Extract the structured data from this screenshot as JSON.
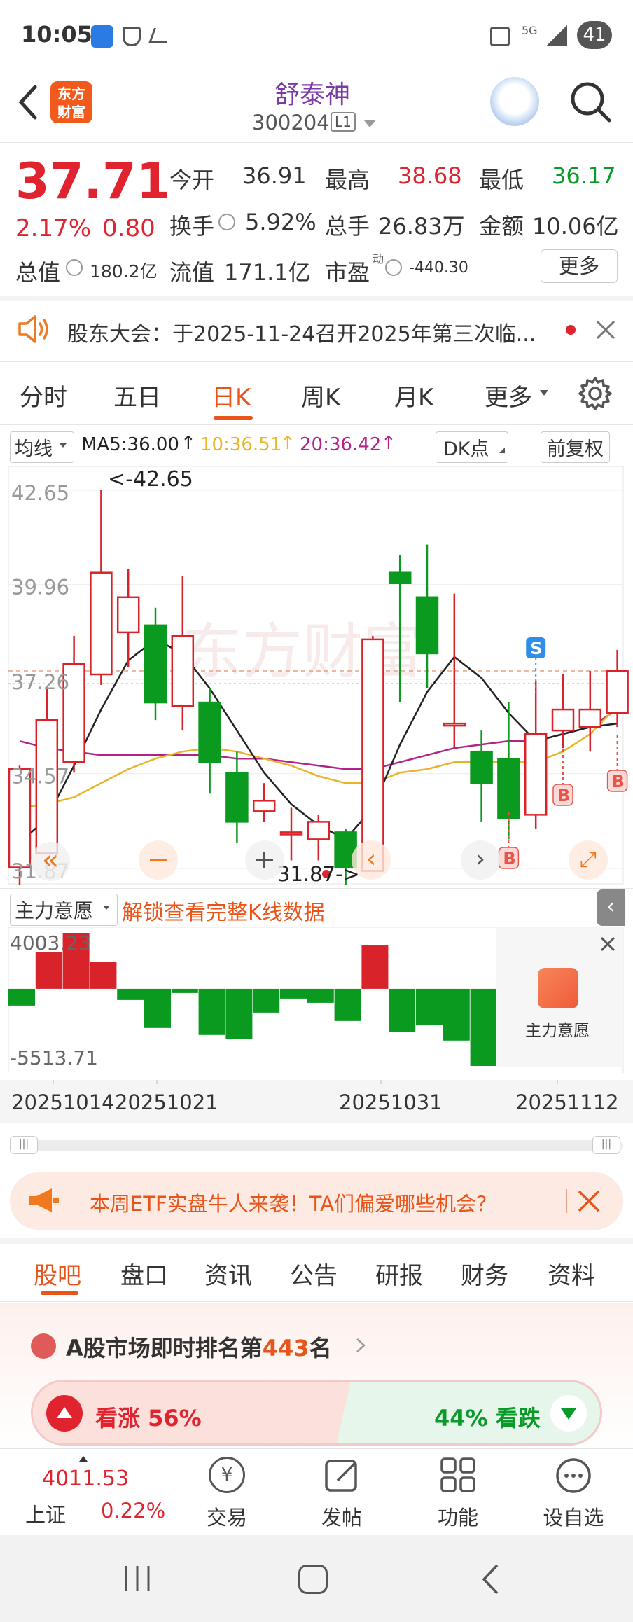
{
  "status_bar": {
    "time": "10:05",
    "network": "5G",
    "battery": "41"
  },
  "header": {
    "logo_line1": "东方",
    "logo_line2": "财富",
    "stock_name": "舒泰神",
    "stock_code": "300204",
    "level": "L1"
  },
  "quote": {
    "price": "37.71",
    "change_pct": "2.17%",
    "change": "0.80",
    "open_label": "今开",
    "open": "36.91",
    "high_label": "最高",
    "high": "38.68",
    "low_label": "最低",
    "low": "36.17",
    "turnover_label": "换手",
    "turnover": "5.92%",
    "volume_label": "总手",
    "volume": "26.83万",
    "amount_label": "金额",
    "amount": "10.06亿",
    "mcap_label": "总值",
    "mcap": "180.2亿",
    "float_label": "流值",
    "float_mcap": "171.1亿",
    "pe_label": "市盈",
    "pe_sup": "动",
    "pe": "-440.30",
    "more_button": "更多"
  },
  "notice": {
    "text": "股东大会：于2025-11-24召开2025年第三次临..."
  },
  "chart_tabs": [
    "分时",
    "五日",
    "日K",
    "周K",
    "月K",
    "更多"
  ],
  "active_tab": "日K",
  "ma_bar": {
    "ma_label": "均线",
    "ma5": "MA5:36.00",
    "ma10": "10:36.51",
    "ma20": "20:36.42",
    "dk": "DK点",
    "adjust": "前复权"
  },
  "indicator_bar": {
    "label": "主力意愿",
    "unlock": "解锁查看完整K线数据",
    "side_label": "主力意愿"
  },
  "chart_data": {
    "type": "candlestick",
    "price_axis": [
      "42.65",
      "39.96",
      "37.26",
      "34.57",
      "31.87"
    ],
    "ylim": [
      31.87,
      42.65
    ],
    "high_marker": "<-42.65",
    "low_marker": "31.87->",
    "dates": [
      "20251014",
      "20251021",
      "20251031",
      "20251112"
    ],
    "candles": [
      {
        "o": 31.9,
        "h": 34.8,
        "l": 31.4,
        "c": 34.7
      },
      {
        "o": 32.3,
        "h": 37.0,
        "l": 32.3,
        "c": 36.1
      },
      {
        "o": 34.9,
        "h": 38.5,
        "l": 34.6,
        "c": 37.7
      },
      {
        "o": 37.4,
        "h": 42.65,
        "l": 37.1,
        "c": 40.3
      },
      {
        "o": 38.6,
        "h": 40.4,
        "l": 37.6,
        "c": 39.6
      },
      {
        "o": 38.8,
        "h": 39.3,
        "l": 36.1,
        "c": 36.6
      },
      {
        "o": 36.5,
        "h": 40.2,
        "l": 35.8,
        "c": 38.5
      },
      {
        "o": 36.6,
        "h": 37.0,
        "l": 34.0,
        "c": 34.9
      },
      {
        "o": 34.6,
        "h": 35.2,
        "l": 32.6,
        "c": 33.2
      },
      {
        "o": 33.5,
        "h": 34.3,
        "l": 33.2,
        "c": 33.8
      },
      {
        "o": 32.9,
        "h": 33.6,
        "l": 32.1,
        "c": 32.9
      },
      {
        "o": 32.7,
        "h": 33.4,
        "l": 32.1,
        "c": 33.2
      },
      {
        "o": 32.9,
        "h": 33.0,
        "l": 31.4,
        "c": 31.9
      },
      {
        "o": 31.8,
        "h": 38.5,
        "l": 31.8,
        "c": 38.4
      },
      {
        "o": 40.3,
        "h": 40.8,
        "l": 36.6,
        "c": 40.0
      },
      {
        "o": 39.6,
        "h": 41.1,
        "l": 37.0,
        "c": 38.0
      },
      {
        "o": 36.0,
        "h": 39.7,
        "l": 35.3,
        "c": 36.0
      },
      {
        "o": 35.2,
        "h": 35.8,
        "l": 33.2,
        "c": 34.3
      },
      {
        "o": 35.0,
        "h": 36.6,
        "l": 32.7,
        "c": 33.3
      },
      {
        "o": 33.4,
        "h": 37.2,
        "l": 33.0,
        "c": 35.7
      },
      {
        "o": 35.8,
        "h": 37.4,
        "l": 35.3,
        "c": 36.4
      },
      {
        "o": 35.9,
        "h": 37.5,
        "l": 35.2,
        "c": 36.4
      },
      {
        "o": 36.3,
        "h": 38.1,
        "l": 35.9,
        "c": 37.5
      }
    ],
    "ma5": [
      32.6,
      33.3,
      34.8,
      36.4,
      37.8,
      38.4,
      38.0,
      37.0,
      35.8,
      34.6,
      33.7,
      33.1,
      32.7,
      33.6,
      35.4,
      36.9,
      37.9,
      37.3,
      36.3,
      35.5,
      35.7,
      35.9,
      36.0
    ],
    "ma10": [
      33.6,
      33.7,
      33.9,
      34.3,
      34.7,
      35.0,
      35.2,
      35.3,
      35.2,
      35.0,
      34.8,
      34.5,
      34.3,
      34.3,
      34.6,
      34.7,
      34.9,
      34.9,
      34.9,
      34.9,
      35.2,
      35.7,
      36.5
    ],
    "ma20": [
      35.5,
      35.3,
      35.2,
      35.1,
      35.1,
      35.1,
      35.1,
      35.1,
      35.0,
      35.0,
      34.9,
      34.8,
      34.7,
      34.7,
      34.9,
      35.1,
      35.3,
      35.4,
      35.5,
      35.5,
      35.7,
      35.9,
      36.4
    ],
    "buy_sell_marks": [
      {
        "label": "S"
      },
      {
        "label": "B"
      },
      {
        "label": "B"
      },
      {
        "label": "B"
      }
    ],
    "indicator": {
      "axis": [
        "4003.23",
        "-5513.71"
      ],
      "ylim": [
        -5513.71,
        4003.23
      ],
      "values": [
        -1200,
        2600,
        4003,
        1900,
        -800,
        -2800,
        -300,
        -3300,
        -3600,
        -1700,
        -700,
        -1000,
        -2300,
        3100,
        -3100,
        -2600,
        -3700,
        -5513
      ]
    }
  },
  "banner": {
    "text": "本周ETF实盘牛人来袭！TA们偏爱哪些机会？"
  },
  "bottom_tabs": [
    "股吧",
    "盘口",
    "资讯",
    "公告",
    "研报",
    "财务",
    "资料"
  ],
  "ranking": {
    "prefix": "A股市场即时排名第",
    "rank": "443",
    "suffix": "名"
  },
  "sentiment": {
    "up_text": "看涨 56%",
    "down_text": "44% 看跌",
    "up": 0.56
  },
  "index": {
    "value": "4011.53",
    "name": "上证",
    "change": "0.22%"
  },
  "nav": {
    "trade": "交易",
    "post": "发帖",
    "func": "功能",
    "watch": "设自选"
  }
}
